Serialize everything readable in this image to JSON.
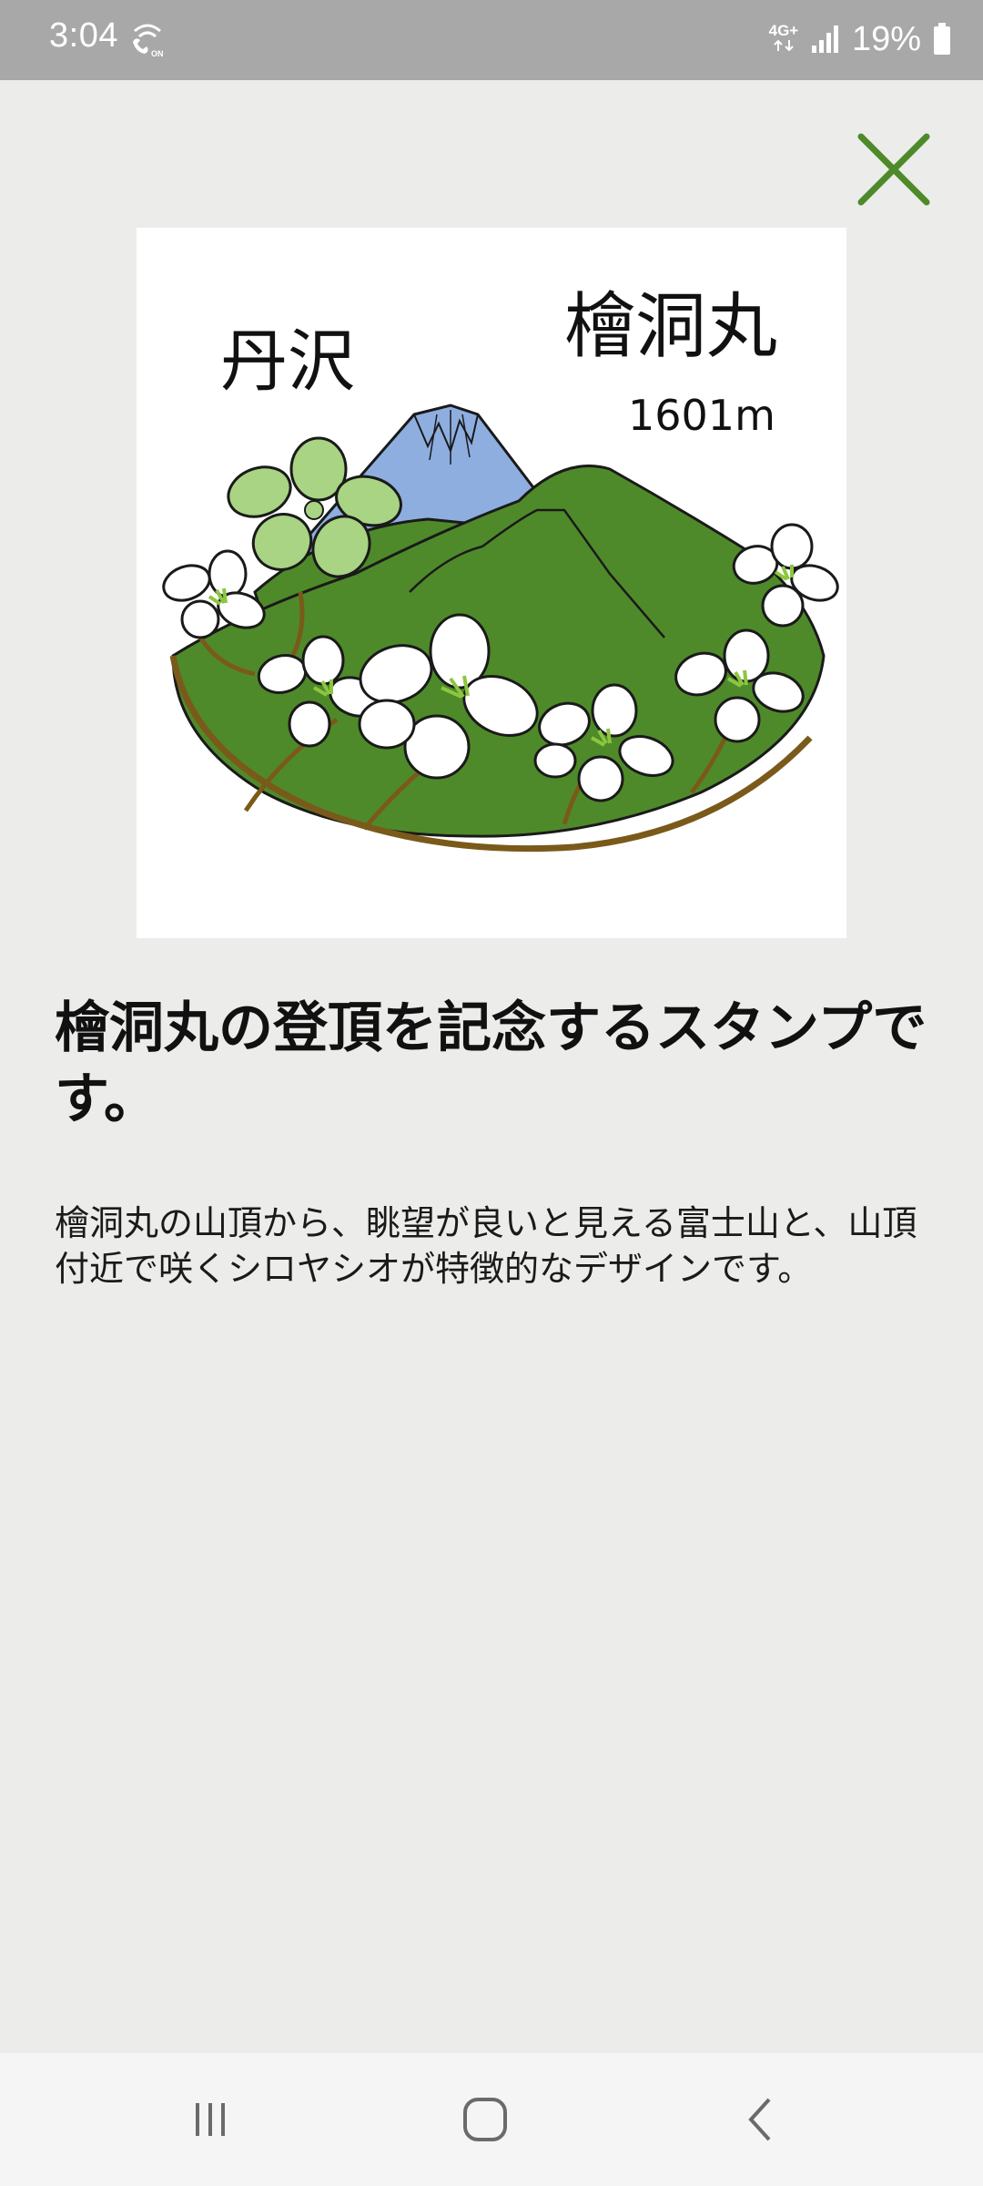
{
  "status_bar": {
    "time": "3:04",
    "wifi_call_icon": "wifi-calling-icon",
    "network_type": "4G+",
    "signal_icon": "signal-bars-icon",
    "battery_percent": "19%",
    "battery_icon": "battery-icon"
  },
  "header": {
    "close_icon": "close-icon",
    "accent_color": "#4f8a2a"
  },
  "stamp": {
    "image_icon": "stamp-illustration",
    "region_text": "丹沢",
    "mountain_name": "檜洞丸",
    "elevation": "1601m"
  },
  "content": {
    "title": "檜洞丸の登頂を記念するスタンプです。",
    "description": "檜洞丸の山頂から、眺望が良いと見える富士山と、山頂付近で咲くシロヤシオが特徴的なデザインです。"
  },
  "nav_bar": {
    "recents_icon": "recents-icon",
    "home_icon": "home-icon",
    "back_icon": "back-icon"
  }
}
